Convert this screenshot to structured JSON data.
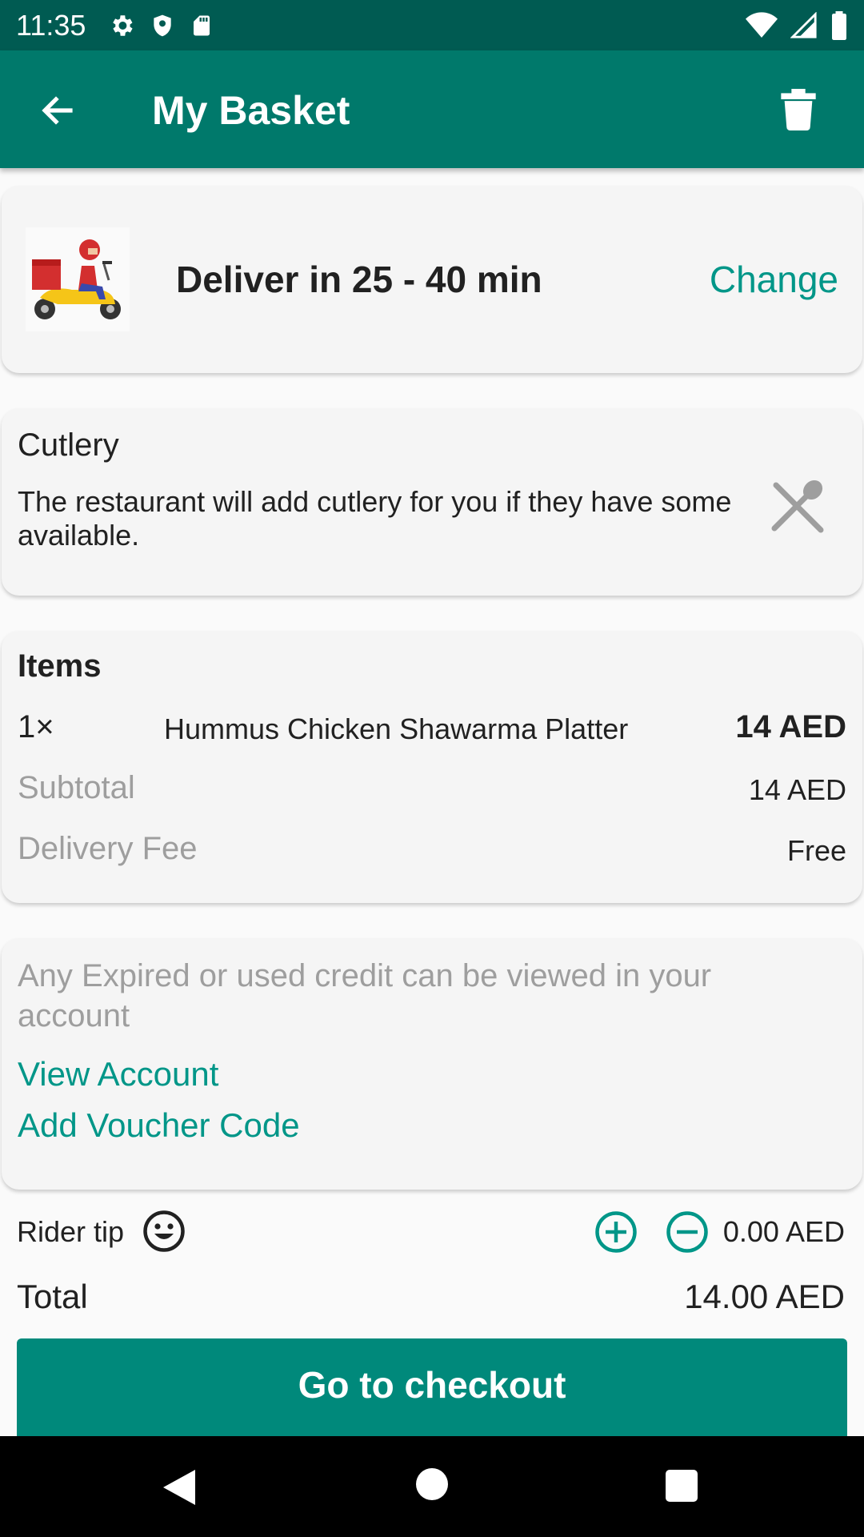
{
  "status_bar": {
    "time": "11:35",
    "left_icons": [
      "gear-icon",
      "shield-icon",
      "sd-card-icon"
    ],
    "right_icons": [
      "wifi-icon",
      "signal-icon",
      "battery-icon"
    ]
  },
  "header": {
    "title": "My Basket",
    "back_icon": "arrow-back-icon",
    "delete_icon": "trash-icon"
  },
  "delivery": {
    "text": "Deliver in 25 - 40 min",
    "change_label": "Change"
  },
  "cutlery": {
    "title": "Cutlery",
    "description": "The restaurant will add cutlery for you if they have some available."
  },
  "items": {
    "title": "Items",
    "list": [
      {
        "qty": "1×",
        "name": "Hummus Chicken Shawarma Platter",
        "price": "14 AED"
      }
    ],
    "subtotal_label": "Subtotal",
    "subtotal_value": "14 AED",
    "delivery_fee_label": "Delivery Fee",
    "delivery_fee_value": "Free"
  },
  "credit": {
    "text": "Any Expired or used credit can be viewed in your account",
    "view_account": "View Account",
    "add_voucher": "Add Voucher Code"
  },
  "tip": {
    "label": "Rider tip",
    "value": "0.00 AED"
  },
  "total": {
    "label": "Total",
    "value": "14.00 AED"
  },
  "checkout": {
    "label": "Go to checkout"
  },
  "colors": {
    "primary": "#00796B",
    "status_bar": "#005B52",
    "accent": "#009688",
    "button": "#00897B"
  }
}
